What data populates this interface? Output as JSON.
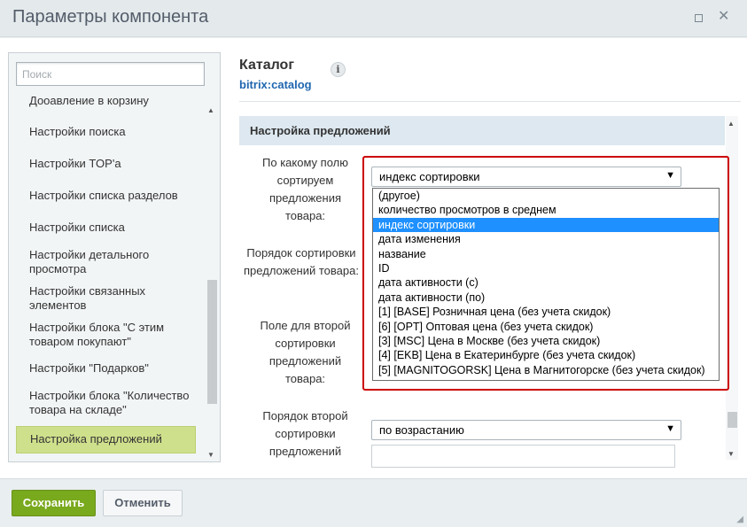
{
  "window": {
    "title": "Параметры компонента"
  },
  "sidebar": {
    "search_placeholder": "Поиск",
    "items": [
      {
        "label": "Дооавление в корзину"
      },
      {
        "label": "Настройки поиска"
      },
      {
        "label": "Настройки TOP'а"
      },
      {
        "label": "Настройки списка разделов"
      },
      {
        "label": "Настройки списка"
      },
      {
        "label": "Настройки детального просмотра"
      },
      {
        "label": "Настройки связанных элементов"
      },
      {
        "label": "Настройки блока \"С этим товаром покупают\""
      },
      {
        "label": "Настройки \"Подарков\""
      },
      {
        "label": "Настройки блока \"Количество товара на складе\""
      },
      {
        "label": "Настройка предложений"
      }
    ]
  },
  "component": {
    "title": "Каталог",
    "code": "bitrix:catalog",
    "info_icon": "i"
  },
  "section": {
    "title": "Настройка предложений"
  },
  "fields": {
    "f1_label": "По какому полю сортируем предложения товара:",
    "f1_value": "индекс сортировки",
    "f2_label": "Порядок сортировки предложений товара:",
    "f3_label": "Поле для второй сортировки предложений товара:",
    "f4_label": "Порядок второй сортировки предложений",
    "f4_value": "по возрастанию"
  },
  "dropdown": {
    "options": [
      "(другое)",
      "количество просмотров в среднем",
      "индекс сортировки",
      "дата изменения",
      "название",
      "ID",
      "дата активности (с)",
      "дата активности (по)",
      "[1] [BASE] Розничная цена (без учета скидок)",
      "[6] [OPT] Оптовая цена (без учета скидок)",
      "[3] [MSC] Цена в Москве (без учета скидок)",
      "[4] [EKB] Цена в Екатеринбурге (без учета скидок)",
      "[5] [MAGNITOGORSK] Цена в Магнитогорске (без учета скидок)"
    ],
    "selected_index": 2
  },
  "footer": {
    "save_label": "Сохранить",
    "cancel_label": "Отменить"
  }
}
